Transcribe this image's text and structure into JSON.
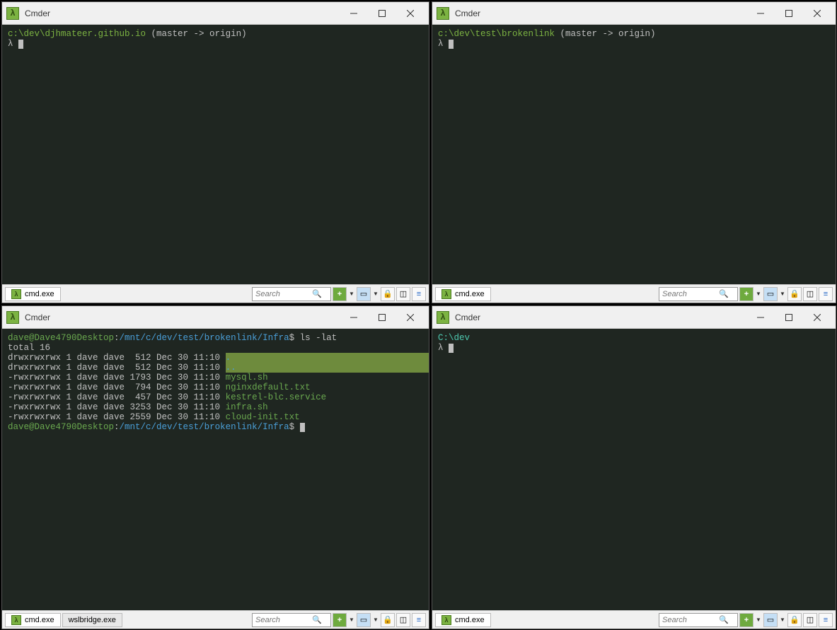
{
  "windows": [
    {
      "title": "Cmder",
      "terminal": {
        "prompt_path": "c:\\dev\\djhmateer.github.io",
        "prompt_branch": " (master -> origin)",
        "lambda": "λ "
      },
      "tabs": [
        {
          "label": "cmd.exe",
          "active": true
        }
      ],
      "search_placeholder": "Search"
    },
    {
      "title": "Cmder",
      "terminal": {
        "prompt_path": "c:\\dev\\test\\brokenlink",
        "prompt_branch": " (master -> origin)",
        "lambda": "λ "
      },
      "tabs": [
        {
          "label": "cmd.exe",
          "active": true
        }
      ],
      "search_placeholder": "Search"
    },
    {
      "title": "Cmder",
      "terminal": {
        "prompt_user": "dave@Dave4790Desktop",
        "prompt_colon": ":",
        "prompt_path_blue": "/mnt/c/dev/test/brokenlink/Infra",
        "prompt_dollar": "$ ",
        "cmd": "ls -lat",
        "total": "total 16",
        "rows": [
          {
            "perm": "drwxrwxrwx 1 dave dave  512 Dec 30 11:10 ",
            "name": ".",
            "dir": true
          },
          {
            "perm": "drwxrwxrwx 1 dave dave  512 Dec 30 11:10 ",
            "name": "..",
            "dir": true
          },
          {
            "perm": "-rwxrwxrwx 1 dave dave 1793 Dec 30 11:10 ",
            "name": "mysql.sh",
            "dir": false
          },
          {
            "perm": "-rwxrwxrwx 1 dave dave  794 Dec 30 11:10 ",
            "name": "nginxdefault.txt",
            "dir": false
          },
          {
            "perm": "-rwxrwxrwx 1 dave dave  457 Dec 30 11:10 ",
            "name": "kestrel-blc.service",
            "dir": false
          },
          {
            "perm": "-rwxrwxrwx 1 dave dave 3253 Dec 30 11:10 ",
            "name": "infra.sh",
            "dir": false
          },
          {
            "perm": "-rwxrwxrwx 1 dave dave 2559 Dec 30 11:10 ",
            "name": "cloud-init.txt",
            "dir": false
          }
        ]
      },
      "tabs": [
        {
          "label": "cmd.exe",
          "active": true
        },
        {
          "label": "wslbridge.exe",
          "active": false
        }
      ],
      "search_placeholder": "Search"
    },
    {
      "title": "Cmder",
      "terminal": {
        "prompt_path_cyan": "C:\\dev",
        "lambda": "λ "
      },
      "tabs": [
        {
          "label": "cmd.exe",
          "active": true
        }
      ],
      "search_placeholder": "Search"
    }
  ]
}
